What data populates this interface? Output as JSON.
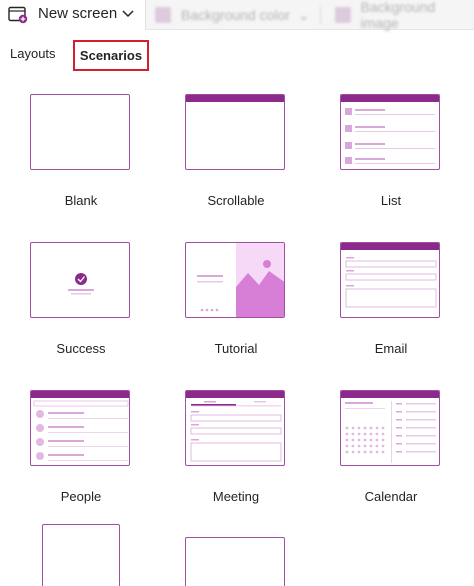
{
  "toolbar": {
    "new_screen_label": "New screen",
    "faded_item_1": "Background color",
    "faded_item_2": "Background image"
  },
  "tabs": [
    {
      "label": "Layouts",
      "selected": false
    },
    {
      "label": "Scenarios",
      "selected": true
    }
  ],
  "templates": [
    {
      "label": "Blank"
    },
    {
      "label": "Scrollable"
    },
    {
      "label": "List"
    },
    {
      "label": "Success"
    },
    {
      "label": "Tutorial"
    },
    {
      "label": "Email"
    },
    {
      "label": "People"
    },
    {
      "label": "Meeting"
    },
    {
      "label": "Calendar"
    }
  ],
  "colors": {
    "accent": "#8b2a8b",
    "accent_light": "#e7bfe7",
    "highlight": "#d2202f"
  }
}
